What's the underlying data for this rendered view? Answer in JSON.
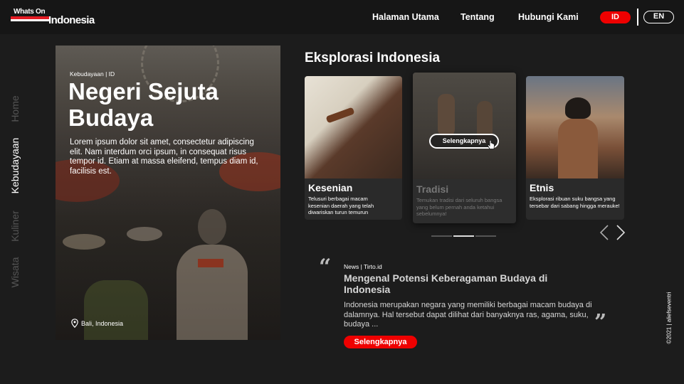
{
  "brand": {
    "logo_top": "Whats On",
    "logo_main": "Indonesia"
  },
  "nav": {
    "home": "Halaman Utama",
    "about": "Tentang",
    "contact": "Hubungi Kami"
  },
  "lang": {
    "active": "ID",
    "other": "EN"
  },
  "sidenav": [
    "Home",
    "Kebudayaan",
    "Kuliner",
    "Wisata"
  ],
  "hero": {
    "kicker": "Kebudayaan | ID",
    "title": "Negeri Sejuta Budaya",
    "description": "Lorem ipsum dolor sit amet, consectetur adipiscing elit. Nam interdum orci ipsum, in consequat risus tempor id. Etiam at massa eleifend, tempus diam id, facilisis est.",
    "location": "Bali, Indonesia"
  },
  "section": {
    "title": "Eksplorasi Indonesia"
  },
  "cards": [
    {
      "title": "Kesenian",
      "description": "Telusuri berbagai macam kesenian daerah yang telah diwariskan turun temurun"
    },
    {
      "title": "Tradisi",
      "description": "Temukan tradisi dari seluruh bangsa yang belum pernah anda ketahui sebelumnya!",
      "button": "Selengkapnya"
    },
    {
      "title": "Etnis",
      "description": "Eksplorasi ribuan suku bangsa yang tersebar dari sabang hingga merauke!"
    }
  ],
  "carousel": {
    "active_index": 1,
    "total": 3
  },
  "news": {
    "kicker": "News | Tirto.id",
    "title": "Mengenal Potensi Keberagaman Budaya di Indonesia",
    "description": "Indonesia merupakan negara yang memiliki berbagai macam budaya di dalamnya. Hal tersebut dapat dilihat dari banyaknya ras, agama, suku, budaya ...",
    "button": "Selengkapnya"
  },
  "footer": {
    "copyright": "©2021 | aliefseventri"
  },
  "colors": {
    "accent": "#ee0000",
    "background": "#1c1c1c"
  }
}
